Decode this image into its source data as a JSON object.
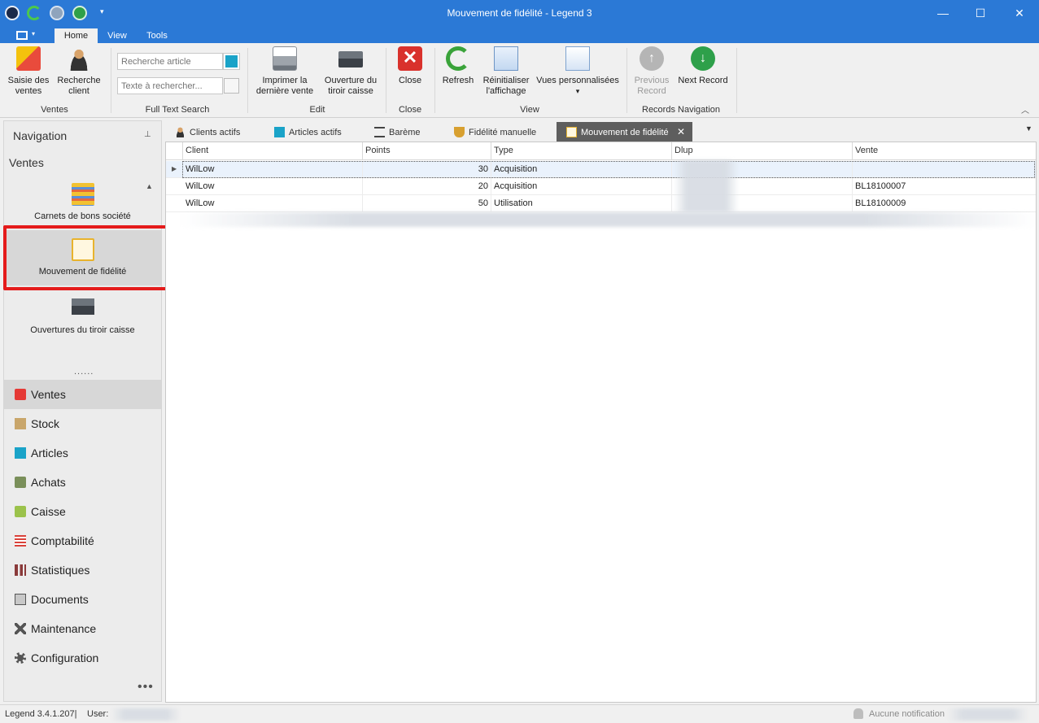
{
  "window": {
    "title": "Mouvement de fidélité - Legend 3",
    "min_glyph": "—",
    "max_glyph": "☐",
    "close_glyph": "✕"
  },
  "ribbon_tabs": [
    {
      "label": "Home",
      "active": true
    },
    {
      "label": "View"
    },
    {
      "label": "Tools"
    }
  ],
  "ribbon": {
    "ventes": {
      "saisie": "Saisie des\nventes",
      "recherche_client": "Recherche\nclient",
      "group": "Ventes"
    },
    "fts": {
      "article_placeholder": "Recherche article",
      "text_placeholder": "Texte à rechercher...",
      "group": "Full Text Search"
    },
    "edit": {
      "imprimer": "Imprimer la\ndernière vente",
      "ouverture": "Ouverture du\ntiroir caisse",
      "group": "Edit"
    },
    "close": {
      "label": "Close",
      "group": "Close",
      "icon_glyph": "✕"
    },
    "view": {
      "refresh": "Refresh",
      "reinit": "Réinitialiser\nl'affichage",
      "vues": "Vues personnalisées",
      "vues_caret": "▾",
      "group": "View"
    },
    "records": {
      "previous": "Previous\nRecord",
      "next": "Next Record",
      "group": "Records Navigation",
      "prev_glyph": "↑",
      "next_glyph": "↓"
    }
  },
  "navigation": {
    "title": "Navigation",
    "group_title": "Ventes",
    "items": [
      {
        "label": "Carnets de bons société"
      },
      {
        "label": "Mouvement de fidélité",
        "selected": true
      },
      {
        "label": "Ouvertures du tiroir caisse"
      }
    ],
    "splitter": "......",
    "groups": [
      {
        "label": "Ventes",
        "icon": "bag-icon",
        "color": "#e53935",
        "selected": true
      },
      {
        "label": "Stock",
        "icon": "box-icon",
        "color": "#c9a66b"
      },
      {
        "label": "Articles",
        "icon": "square-icon",
        "color": "#1aa3c8"
      },
      {
        "label": "Achats",
        "icon": "truck-icon",
        "color": "#7a8f5a"
      },
      {
        "label": "Caisse",
        "icon": "cash-icon",
        "color": "#9bc24b"
      },
      {
        "label": "Comptabilité",
        "icon": "ledger-icon",
        "color": "#d9423a"
      },
      {
        "label": "Statistiques",
        "icon": "sigma-icon",
        "color": "#8a3a3a"
      },
      {
        "label": "Documents",
        "icon": "document-icon",
        "color": "#555555"
      },
      {
        "label": "Maintenance",
        "icon": "tools-icon",
        "color": "#555555"
      },
      {
        "label": "Configuration",
        "icon": "gear-icon",
        "color": "#555555"
      }
    ],
    "more": "•••"
  },
  "doc_tabs": [
    {
      "label": "Clients actifs",
      "icon": "person-icon"
    },
    {
      "label": "Articles actifs",
      "icon": "square-icon"
    },
    {
      "label": "Barème",
      "icon": "scale-icon"
    },
    {
      "label": "Fidélité manuelle",
      "icon": "trophy-icon"
    },
    {
      "label": "Mouvement de fidélité",
      "icon": "document-icon",
      "active": true
    }
  ],
  "tab_close_glyph": "✕",
  "tab_menu_glyph": "▼",
  "grid": {
    "columns": [
      "Client",
      "Points",
      "Type",
      "Dlup",
      "Vente"
    ],
    "rows": [
      {
        "client": "WilLow",
        "points": "30",
        "type": "Acquisition",
        "dlup": "",
        "vente": ""
      },
      {
        "client": "WilLow",
        "points": "20",
        "type": "Acquisition",
        "dlup": "",
        "vente": "BL18100007"
      },
      {
        "client": "WilLow",
        "points": "50",
        "type": "Utilisation",
        "dlup": "",
        "vente": "BL18100009"
      }
    ]
  },
  "status": {
    "version": "Legend 3.4.1.207|",
    "user_label": "User:",
    "notification": "Aucune notification"
  }
}
